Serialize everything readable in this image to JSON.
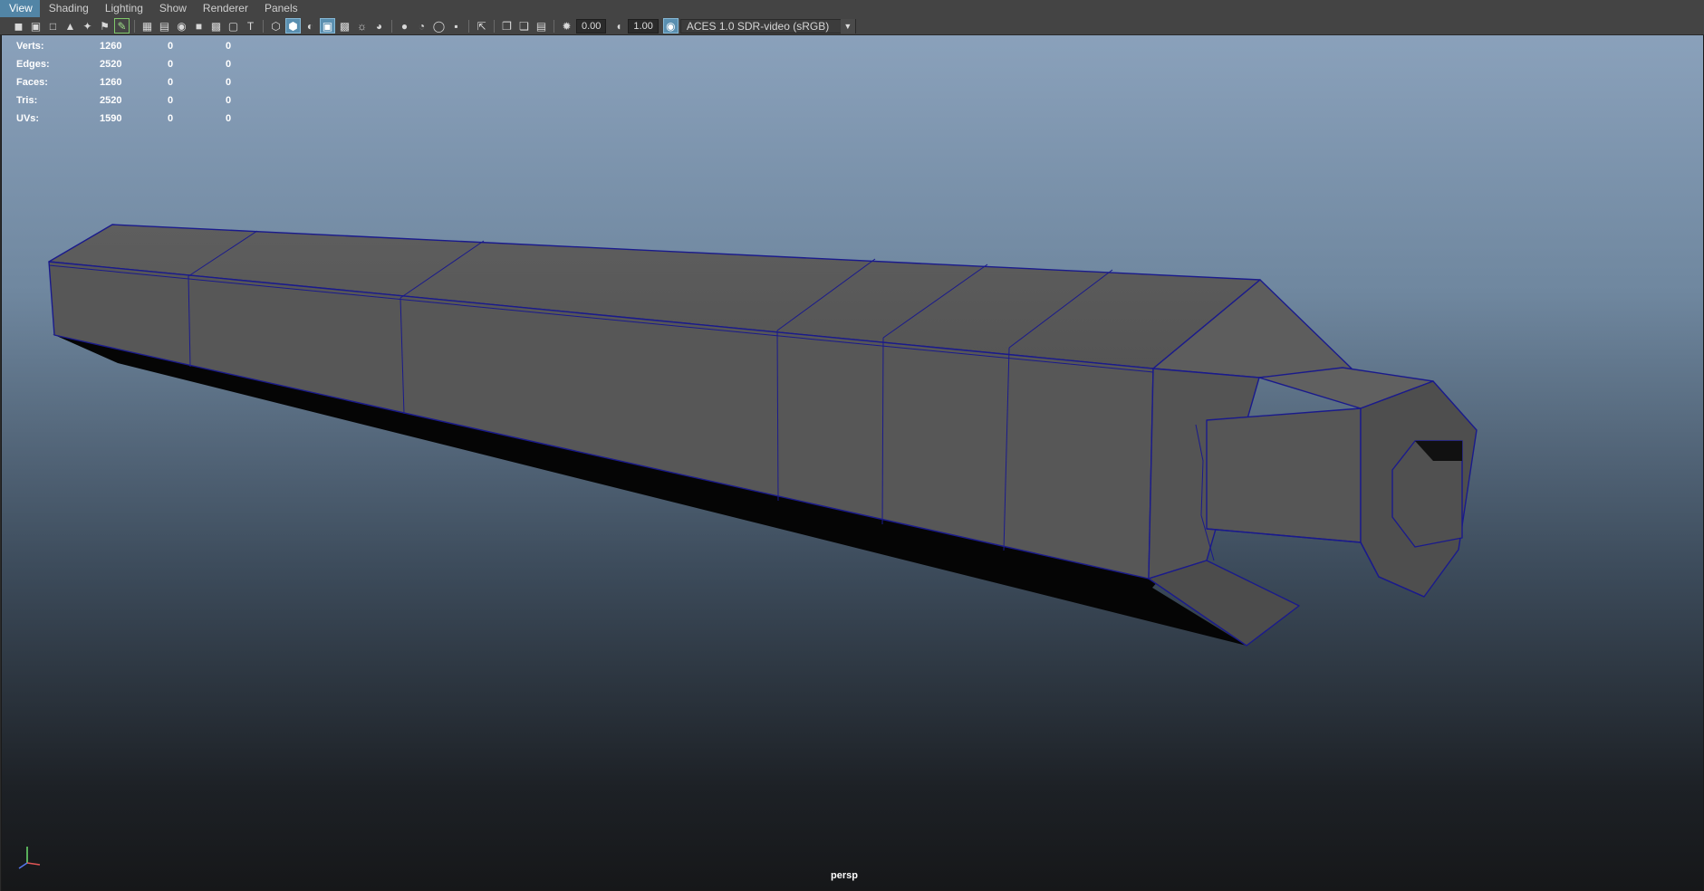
{
  "menu": {
    "items": [
      "View",
      "Shading",
      "Lighting",
      "Show",
      "Renderer",
      "Panels"
    ]
  },
  "toolbar": {
    "icons": [
      "camera-icon",
      "camera-attributes-icon",
      "bookmark-icon",
      "image-plane-icon",
      "pencil-icon",
      "grid-icon",
      "film-gate-icon",
      "resolution-gate-icon",
      "gate-mask-icon",
      "field-chart-icon",
      "safe-action-icon",
      "safe-title-icon",
      "wireframe-icon",
      "smooth-shade-icon",
      "use-lights-icon",
      "xray-icon",
      "isolate-icon",
      "textured-icon",
      "shadows-icon",
      "ambient-occlusion-icon",
      "motion-blur-icon",
      "anti-aliasing-icon",
      "depth-of-field-icon",
      "select-camera-icon",
      "display-layer-icon",
      "hud-icon",
      "exposure-icon",
      "gamma-icon",
      "color-management-icon"
    ],
    "exposure_value": "0.00",
    "gamma_value": "1.00",
    "view_transform": "ACES 1.0 SDR-video (sRGB)"
  },
  "hud": {
    "rows": [
      {
        "label": "Verts:",
        "v1": "1260",
        "v2": "0",
        "v3": "0"
      },
      {
        "label": "Edges:",
        "v1": "2520",
        "v2": "0",
        "v3": "0"
      },
      {
        "label": "Faces:",
        "v1": "1260",
        "v2": "0",
        "v3": "0"
      },
      {
        "label": "Tris:",
        "v1": "2520",
        "v2": "0",
        "v3": "0"
      },
      {
        "label": "UVs:",
        "v1": "1590",
        "v2": "0",
        "v3": "0"
      }
    ]
  },
  "viewport": {
    "camera": "persp",
    "background_top": "#8aa1bb",
    "background_bottom": "#161719",
    "mesh_color": "#5a5a5a",
    "wire_color": "#1a1a8c"
  }
}
